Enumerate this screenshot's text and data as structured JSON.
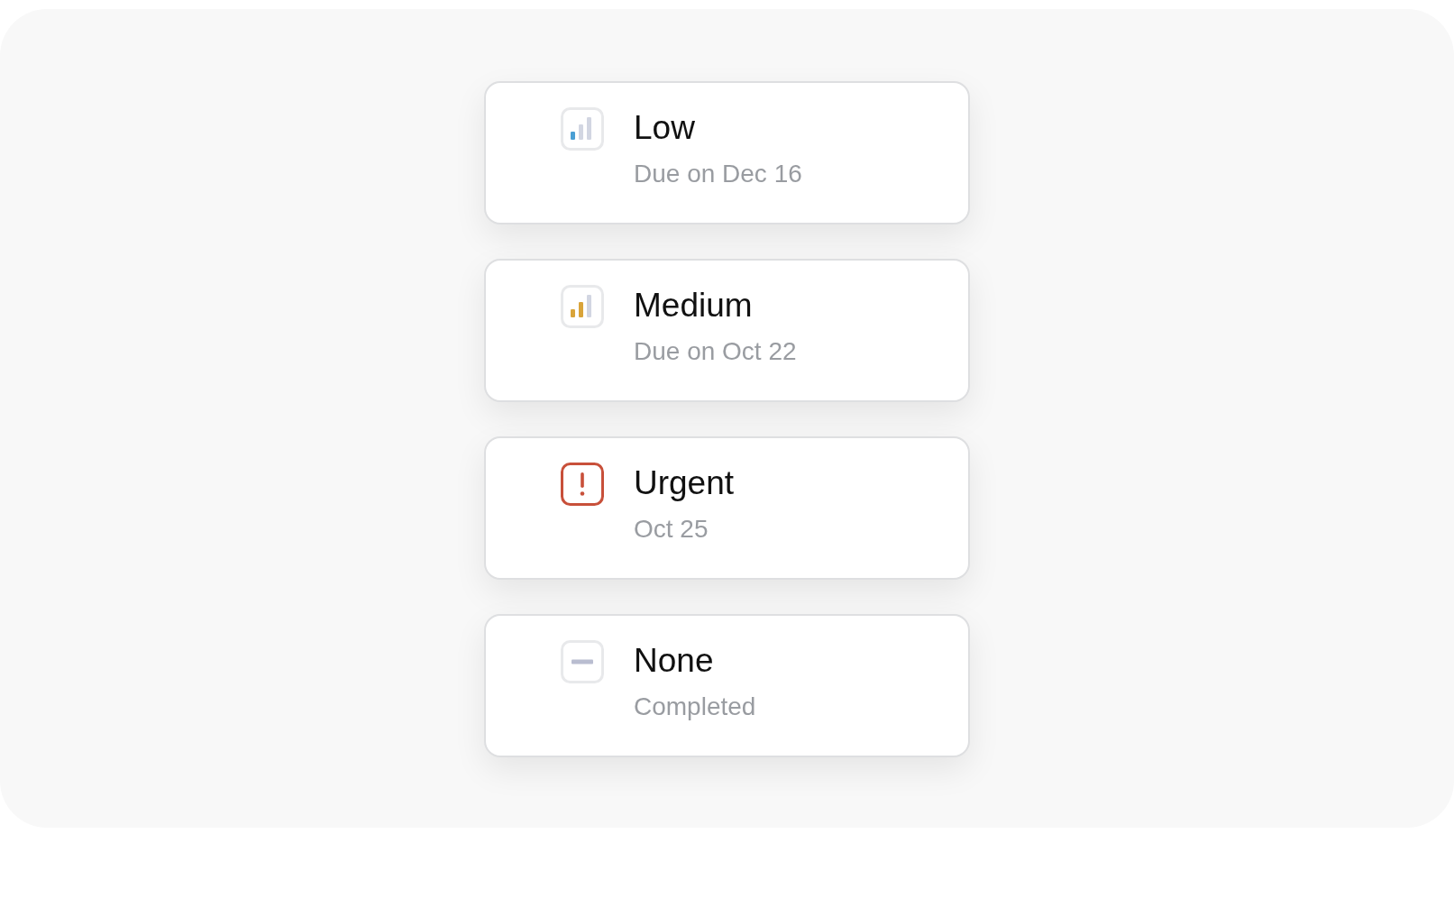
{
  "items": [
    {
      "kind": "low",
      "title": "Low",
      "subtitle": "Due on Dec 16",
      "color": "#4a9fd4"
    },
    {
      "kind": "medium",
      "title": "Medium",
      "subtitle": "Due on Oct 22",
      "color": "#d9a43a"
    },
    {
      "kind": "urgent",
      "title": "Urgent",
      "subtitle": "Oct 25",
      "color": "#c8503a"
    },
    {
      "kind": "none",
      "title": "None",
      "subtitle": "Completed",
      "color": "#b9bdd0"
    }
  ]
}
